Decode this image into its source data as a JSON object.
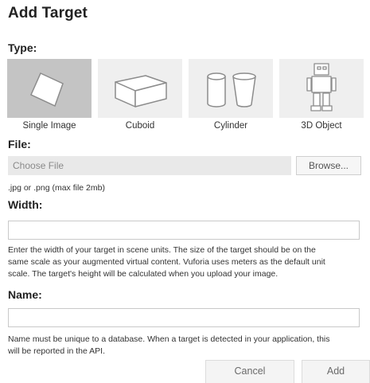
{
  "dialog": {
    "title": "Add Target"
  },
  "type_section": {
    "label": "Type:",
    "selected": "Single Image",
    "options": [
      {
        "label": "Single Image",
        "icon": "single-image-icon"
      },
      {
        "label": "Cuboid",
        "icon": "cuboid-icon"
      },
      {
        "label": "Cylinder",
        "icon": "cylinder-icon"
      },
      {
        "label": "3D Object",
        "icon": "3d-object-icon"
      }
    ]
  },
  "file_section": {
    "label": "File:",
    "placeholder": "Choose File",
    "browse_label": "Browse...",
    "hint": ".jpg or .png (max file 2mb)"
  },
  "width_section": {
    "label": "Width:",
    "value": "",
    "help_lines": [
      "Enter the width of your target in scene units. The size of the target should be on the",
      "same scale as your augmented virtual content. Vuforia uses meters as the default unit",
      "scale. The target's height will be calculated when you upload your image."
    ]
  },
  "name_section": {
    "label": "Name:",
    "value": "",
    "help_lines": [
      "Name must be unique to a database. When a target is detected in your application, this",
      "will be reported in the API."
    ]
  },
  "footer": {
    "cancel_label": "Cancel",
    "add_label": "Add"
  },
  "colors": {
    "selected_tile": "#c4c4c4",
    "tile": "#efefef",
    "icon_stroke": "#8c8c8c"
  }
}
